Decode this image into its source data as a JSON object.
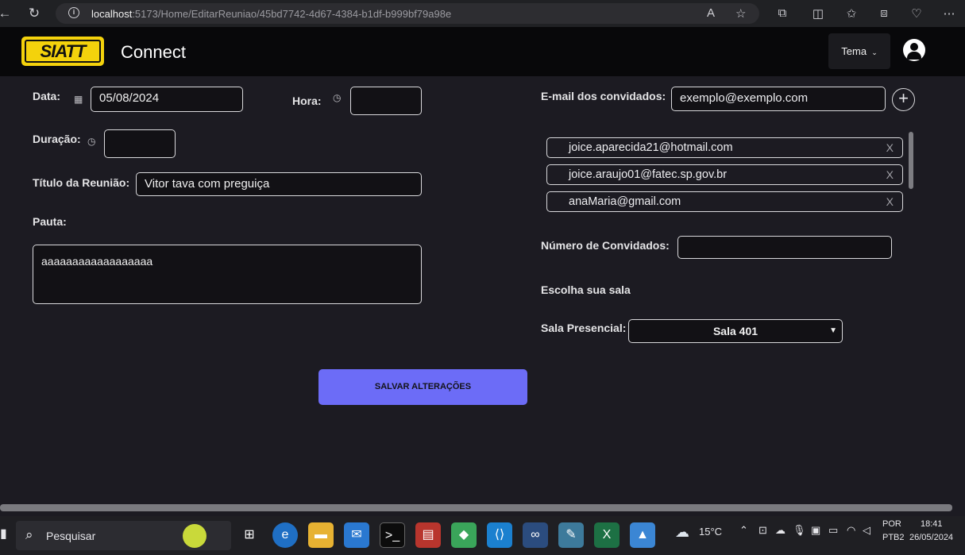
{
  "browser": {
    "url_host": "localhost",
    "url_rest": ":5173/Home/EditarReuniao/45bd7742-4d67-4384-b1df-b999bf79a98e"
  },
  "header": {
    "logo_text": "SIATT",
    "brand": "Connect",
    "theme_label": "Tema"
  },
  "form": {
    "date_label": "Data:",
    "date_value": "05/08/2024",
    "time_label": "Hora:",
    "time_value": "",
    "duration_label": "Duração:",
    "duration_value": "",
    "title_label": "Título da Reunião:",
    "title_value": "Vitor tava com preguiça",
    "agenda_label": "Pauta:",
    "agenda_value": "aaaaaaaaaaaaaaaaaa",
    "emails_label": "E-mail dos convidados:",
    "email_placeholder": "exemplo@exemplo.com",
    "guests": [
      {
        "email": "joice.aparecida21@hotmail.com",
        "remove": "X"
      },
      {
        "email": "joice.araujo01@fatec.sp.gov.br",
        "remove": "X"
      },
      {
        "email": "anaMaria@gmail.com",
        "remove": "X"
      }
    ],
    "guest_count_label": "Número de Convidados:",
    "guest_count_value": "",
    "room_heading": "Escolha sua sala",
    "room_label": "Sala Presencial:",
    "room_value": "Sala 401",
    "save_label": "SALVAR ALTERAÇÕES"
  },
  "taskbar": {
    "search_label": "Pesquisar",
    "weather": "15°C",
    "lang_top": "POR",
    "lang_bottom": "PTB2",
    "time": "18:41",
    "date": "26/05/2024"
  }
}
